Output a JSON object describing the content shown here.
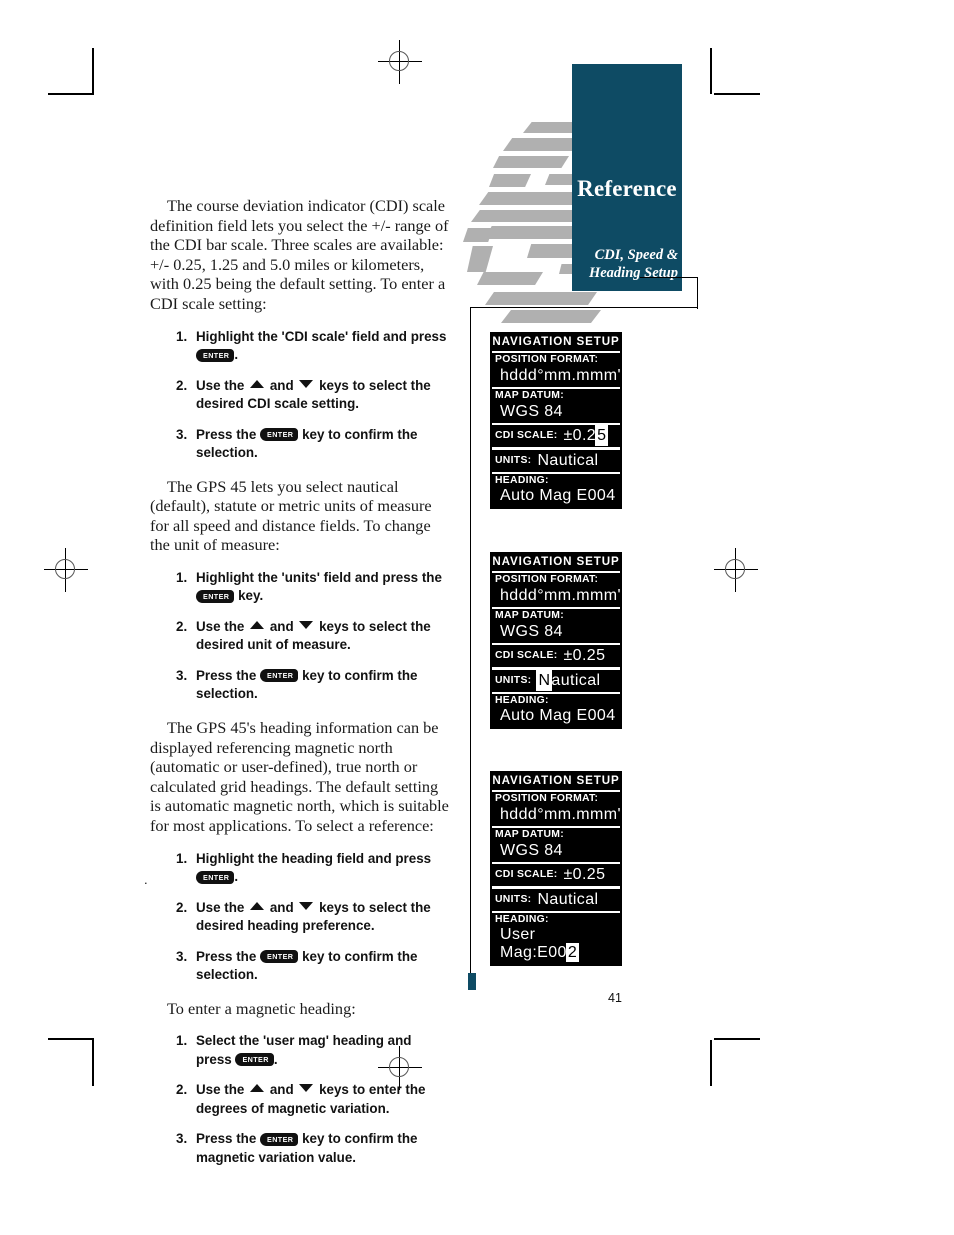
{
  "header": {
    "ref_title": "Reference",
    "ref_subtitle_line1": "CDI, Speed &",
    "ref_subtitle_line2": "Heading Setup",
    "accent_color": "#0e4b64",
    "globe_color": "#b0b0b0"
  },
  "page": {
    "number": "41",
    "stray_mark": "."
  },
  "body": {
    "para1": "The course deviation indicator (CDI) scale definition field lets you select the +/- range of the CDI bar scale. Three scales are available: +/- 0.25, 1.25 and 5.0 miles or kilometers, with 0.25 being the default setting. To enter a CDI scale setting:",
    "para2": "The GPS 45 lets you select nautical (default), statute or metric units of measure for all speed and distance fields. To change the unit of measure:",
    "para3": "The GPS 45's heading information can be displayed referencing magnetic north (automatic or user-defined), true north or calculated grid headings. The default setting is automatic magnetic north, which is suitable for most applications. To select a reference:",
    "para4": "To enter a magnetic heading:"
  },
  "steps_cdi": [
    {
      "num": "1.",
      "pre": "Highlight the 'CDI scale' field and press ",
      "key": "ENTER",
      "post": "."
    },
    {
      "num": "2.",
      "pre": "Use the ",
      "mid": " and ",
      "post2": " keys to select the desired CDI scale setting."
    },
    {
      "num": "3.",
      "pre": "Press the ",
      "key": "ENTER",
      "post": " key to confirm the selection."
    }
  ],
  "steps_units": [
    {
      "num": "1.",
      "pre": "Highlight the 'units' field and press the ",
      "key": "ENTER",
      "post": " key."
    },
    {
      "num": "2.",
      "pre": "Use the ",
      "mid": " and ",
      "post2": " keys to select the desired unit of measure."
    },
    {
      "num": "3.",
      "pre": "Press the ",
      "key": "ENTER",
      "post": " key to confirm the selection."
    }
  ],
  "steps_heading": [
    {
      "num": "1.",
      "pre": "Highlight the heading field and press ",
      "key": "ENTER",
      "post": "."
    },
    {
      "num": "2.",
      "pre": "Use the ",
      "mid": " and ",
      "post2": " keys to select the desired heading preference."
    },
    {
      "num": "3.",
      "pre": "Press the ",
      "key": "ENTER",
      "post": " key to confirm the selection."
    }
  ],
  "steps_usermag": [
    {
      "num": "1.",
      "pre": "Select the 'user mag' heading and press ",
      "key": "ENTER",
      "post": "."
    },
    {
      "num": "2.",
      "pre": "Use the ",
      "mid": " and ",
      "post2": " keys to enter the degrees of magnetic variation."
    },
    {
      "num": "3.",
      "pre": "Press the ",
      "key": "ENTER",
      "post": " key to confirm the magnetic variation value."
    }
  ],
  "screens": [
    {
      "title": "NAVIGATION SETUP",
      "position_format_label": "POSITION FORMAT:",
      "position_format_value": "hddd°mm.mmm'",
      "map_datum_label": "MAP DATUM:",
      "map_datum_value": "WGS 84",
      "cdi_label": "CDI SCALE:",
      "cdi_value_plain": "±0.2",
      "cdi_value_hl": "5",
      "units_label": "UNITS:",
      "units_value_hl": "",
      "units_value_plain": "Nautical",
      "heading_label": "HEADING:",
      "heading_value_plain": "Auto Mag E004",
      "heading_value_hl": ""
    },
    {
      "title": "NAVIGATION SETUP",
      "position_format_label": "POSITION FORMAT:",
      "position_format_value": "hddd°mm.mmm'",
      "map_datum_label": "MAP DATUM:",
      "map_datum_value": "WGS 84",
      "cdi_label": "CDI SCALE:",
      "cdi_value_plain": "±0.25",
      "cdi_value_hl": "",
      "units_label": "UNITS:",
      "units_value_hl": "N",
      "units_value_plain": "autical",
      "heading_label": "HEADING:",
      "heading_value_plain": "Auto Mag E004",
      "heading_value_hl": ""
    },
    {
      "title": "NAVIGATION SETUP",
      "position_format_label": "POSITION FORMAT:",
      "position_format_value": "hddd°mm.mmm'",
      "map_datum_label": "MAP DATUM:",
      "map_datum_value": "WGS 84",
      "cdi_label": "CDI SCALE:",
      "cdi_value_plain": "±0.25",
      "cdi_value_hl": "",
      "units_label": "UNITS:",
      "units_value_hl": "",
      "units_value_plain": "Nautical",
      "heading_label": "HEADING:",
      "heading_value_plain": "User Mag:E00",
      "heading_value_hl": "2"
    }
  ]
}
